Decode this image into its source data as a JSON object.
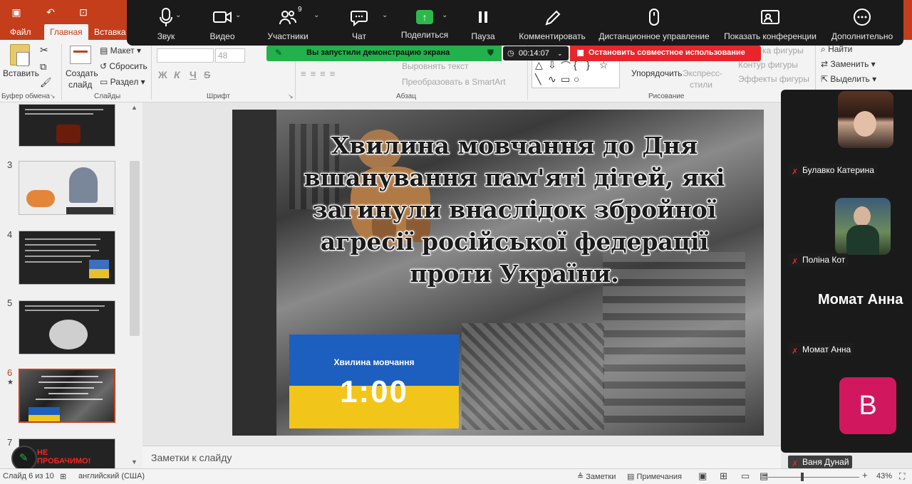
{
  "ppt": {
    "tabs": [
      "Файл",
      "Главная",
      "Вставка"
    ],
    "active_tab": "Главная",
    "ribbon": {
      "paste": "Вставить",
      "clipboard": "Буфер обмена",
      "new_slide_1": "Создать",
      "new_slide_2": "слайд",
      "layout": "Макет",
      "reset": "Сбросить",
      "section": "Раздел",
      "slides_group": "Слайды",
      "font_size": "48",
      "font_group": "Шрифт",
      "fmt_bold": "Ж",
      "fmt_italic": "К",
      "fmt_underline": "Ч",
      "fmt_strike": "S",
      "align_text": "Выровнять текст",
      "smartart": "Преобразовать в SmartArt",
      "paragraph_group": "Абзац",
      "arrange": "Упорядочить",
      "quick_styles_1": "Экспресс-",
      "quick_styles_2": "стили",
      "shape_fill": "ка фигуры",
      "shape_outline": "Контур фигуры",
      "shape_effects": "Эффекты фигуры",
      "drawing_group": "Рисование",
      "find": "Найти",
      "replace": "Заменить",
      "select": "Выделить"
    },
    "thumbnails": [
      {
        "num": "3"
      },
      {
        "num": "4"
      },
      {
        "num": "5"
      },
      {
        "num": "6",
        "star": "★"
      },
      {
        "num": "7"
      }
    ],
    "slide": {
      "title": "Хвилина мовчання до Дня вшанування пам'яті дітей, які загинули внаслідок збройної агресії російської федерації проти України.",
      "flag_caption": "Хвилина мовчання",
      "flag_time": "1:00"
    },
    "notes_placeholder": "Заметки к слайду",
    "status": {
      "slide_counter": "Слайд 6 из 10",
      "language": "английский (США)",
      "notes": "Заметки",
      "comments": "Примечания",
      "zoom": "43%"
    }
  },
  "zoom": {
    "toolbar": [
      {
        "label": "Звук"
      },
      {
        "label": "Видео"
      },
      {
        "label": "Участники",
        "count": "9"
      },
      {
        "label": "Чат"
      },
      {
        "label": "Поделиться"
      },
      {
        "label": "Пауза"
      },
      {
        "label": "Комментировать"
      },
      {
        "label": "Дистанционное управление"
      },
      {
        "label": "Показать конференции"
      },
      {
        "label": "Дополнительно"
      }
    ],
    "share_status": "Вы запустили демонстрацию экрана",
    "timer": "00:14:07",
    "stop_share": "Остановить совместное использование",
    "participants": [
      {
        "name": "Булавко Катерина"
      },
      {
        "name": "Поліна Кот"
      },
      {
        "name": "Момат Анна",
        "display": "Момат Анна"
      },
      {
        "name": "Ваня Дунай",
        "initial": "В"
      }
    ],
    "annotate_badge": "НЕ ПРОБАЧИМО!"
  },
  "colors": {
    "ppt_brand": "#c43e1c",
    "share_green": "#22b14c",
    "stop_red": "#e8252b",
    "avatar_pink": "#d1185e"
  }
}
